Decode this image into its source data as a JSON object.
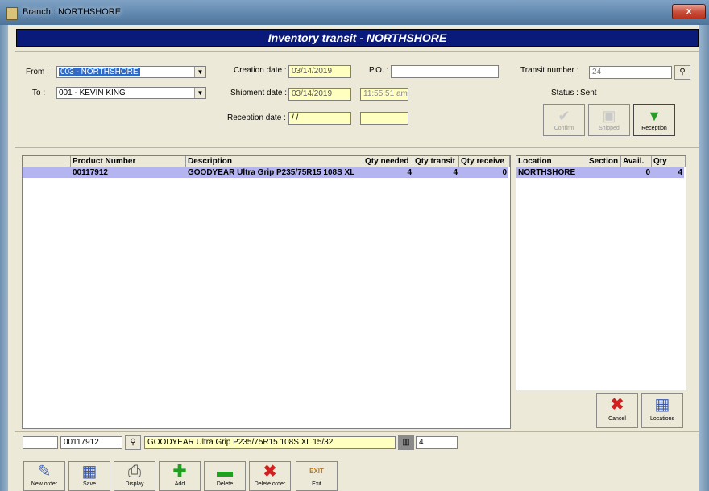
{
  "window": {
    "title": "Branch : NORTHSHORE",
    "close_label": "x"
  },
  "banner": {
    "title": "Inventory transit - NORTHSHORE"
  },
  "form": {
    "from_label": "From :",
    "from_value": "003 - NORTHSHORE",
    "to_label": "To :",
    "to_value": "001 - KEVIN KING",
    "creation_date_label": "Creation date :",
    "creation_date_value": "03/14/2019",
    "po_label": "P.O. :",
    "po_value": "",
    "transit_number_label": "Transit number :",
    "transit_number_value": "24",
    "shipment_date_label": "Shipment date :",
    "shipment_date_value": "03/14/2019",
    "shipment_time_value": "11:55:51 am",
    "status_label": "Status :",
    "status_value": "Sent",
    "reception_date_label": "Reception date :",
    "reception_date_value": " / /",
    "reception_time_value": ""
  },
  "actions": {
    "confirm": "Confirm",
    "shipped": "Shipped",
    "reception": "Reception"
  },
  "products": {
    "columns": [
      "Product Number",
      "Description",
      "Qty needed",
      "Qty transit",
      "Qty receive"
    ],
    "rows": [
      {
        "product_number": "00117912",
        "description": "GOODYEAR Ultra Grip P235/75R15 108S XL",
        "qty_needed": "4",
        "qty_transit": "4",
        "qty_receive": "0"
      }
    ]
  },
  "locations": {
    "columns": [
      "Location",
      "Section",
      "Avail.",
      "Qty"
    ],
    "rows": [
      {
        "location": "NORTHSHORE",
        "section": "",
        "avail": "0",
        "qty": "4"
      }
    ],
    "cancel_label": "Cancel",
    "locations_label": "Locations"
  },
  "entry": {
    "blank_value": "",
    "product_value": "00117912",
    "description_value": "GOODYEAR Ultra Grip P235/75R15 108S XL 15/32",
    "qty_value": "4"
  },
  "toolbar": {
    "new_order": "New order",
    "save": "Save",
    "display": "Display",
    "add": "Add",
    "delete": "Delete",
    "delete_order": "Delete order",
    "exit": "Exit",
    "exit_sign": "EXIT"
  },
  "colors": {
    "banner_bg": "#0a1a7a",
    "selected_row": "#b4b4f0",
    "date_field": "#ffffc0"
  }
}
